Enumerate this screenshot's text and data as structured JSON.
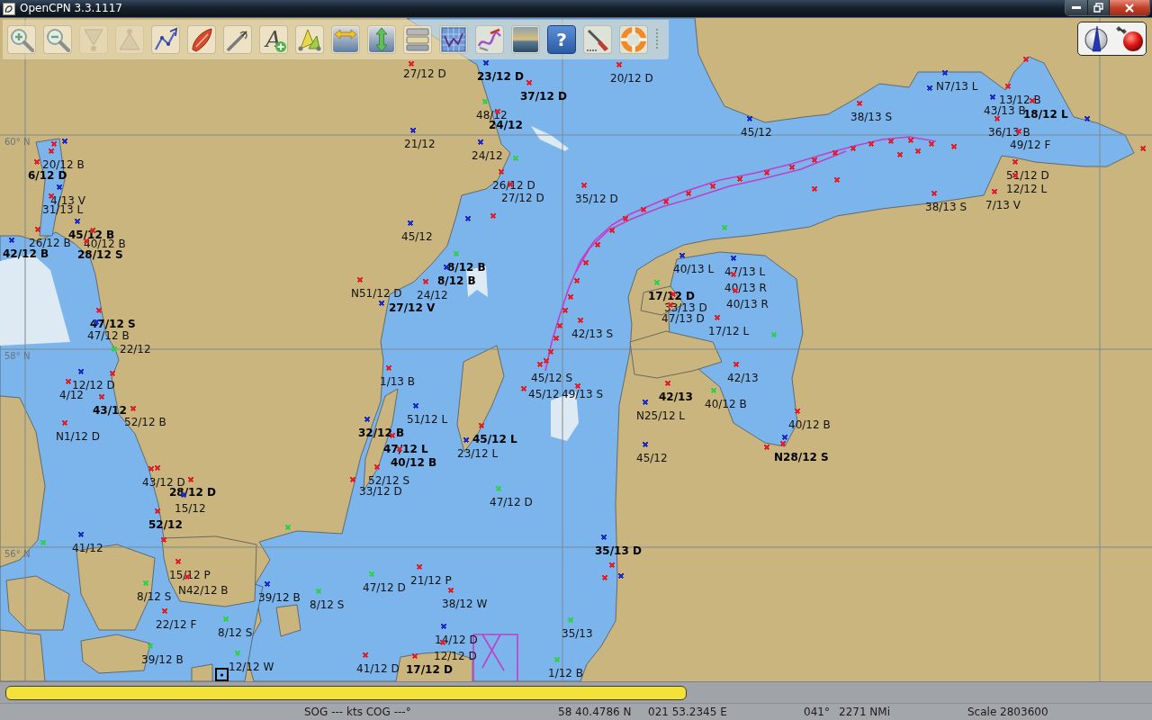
{
  "window": {
    "title": "OpenCPN 3.3.1117"
  },
  "toolbar": {
    "tools": [
      {
        "kind": "zoom_in",
        "disabled": false
      },
      {
        "kind": "zoom_out",
        "disabled": false
      },
      {
        "kind": "scale_down",
        "disabled": true
      },
      {
        "kind": "scale_up",
        "disabled": true
      },
      {
        "kind": "route",
        "disabled": false
      },
      {
        "kind": "own_ship",
        "disabled": false
      },
      {
        "kind": "measure",
        "disabled": false
      },
      {
        "kind": "add_text",
        "symbol": "A",
        "disabled": false
      },
      {
        "kind": "track",
        "disabled": false
      },
      {
        "kind": "h_arrows",
        "disabled": false
      },
      {
        "kind": "v_arrows",
        "disabled": false
      },
      {
        "kind": "layers",
        "disabled": false
      },
      {
        "kind": "graph",
        "disabled": false
      },
      {
        "kind": "route_manager",
        "disabled": false
      },
      {
        "kind": "sunset",
        "disabled": false
      },
      {
        "kind": "help",
        "symbol": "?",
        "disabled": false
      },
      {
        "kind": "brush",
        "disabled": false
      },
      {
        "kind": "lifebuoy",
        "disabled": false
      }
    ]
  },
  "compass": {
    "gps_fix": false
  },
  "chart": {
    "grid_labels": [
      "60° N",
      "58° N",
      "56° N"
    ],
    "marks": [
      {
        "name": "20/12 B",
        "color": "#e0202c"
      },
      {
        "name": "6/12 D",
        "color": "#e0202c"
      },
      {
        "name": "4/13 V",
        "color": "#1c2cc8"
      },
      {
        "name": "31/13 L",
        "color": "#e0202c"
      },
      {
        "name": "45/12 B",
        "color": "#1c2cc8"
      },
      {
        "name": "26/12 B",
        "color": "#e0202c"
      },
      {
        "name": "40/12 B",
        "color": "#e0202c"
      },
      {
        "name": "42/12 B",
        "color": "#1c2cc8"
      },
      {
        "name": "28/12 S",
        "color": "#e0202c"
      },
      {
        "name": "47/12 S",
        "color": "#e0202c"
      },
      {
        "name": "47/12 B",
        "color": "#1c2cc8"
      },
      {
        "name": "22/12",
        "color": "#2ed24a"
      },
      {
        "name": "12/12 D",
        "color": "#1c2cc8"
      },
      {
        "name": "4/12",
        "color": "#e0202c"
      },
      {
        "name": "43/12",
        "color": "#e0202c"
      },
      {
        "name": "52/12 B",
        "color": "#e0202c"
      },
      {
        "name": "N1/12 D",
        "color": "#e0202c"
      },
      {
        "name": "43/12 D",
        "color": "#e0202c"
      },
      {
        "name": "28/12 D",
        "color": "#e0202c"
      },
      {
        "name": "15/12",
        "color": "#1c2cc8"
      },
      {
        "name": "52/12",
        "color": "#e0202c"
      },
      {
        "name": "41/12",
        "color": "#1c2cc8"
      },
      {
        "name": "15/12 P",
        "color": "#e0202c"
      },
      {
        "name": "N42/12 B",
        "color": "#e0202c"
      },
      {
        "name": "8/12 S",
        "color": "#2ed24a"
      },
      {
        "name": "39/12 B",
        "color": "#1c2cc8"
      },
      {
        "name": "8/12 S",
        "color": "#2ed24a"
      },
      {
        "name": "22/12 F",
        "color": "#e0202c"
      },
      {
        "name": "8/12 S",
        "color": "#2ed24a"
      },
      {
        "name": "39/12 B",
        "color": "#2ed24a"
      },
      {
        "name": "12/12 W",
        "color": "#2ed24a"
      },
      {
        "name": "27/12 D",
        "color": "#e0202c"
      },
      {
        "name": "23/12 D",
        "color": "#1c2cc8"
      },
      {
        "name": "20/12 D",
        "color": "#e0202c"
      },
      {
        "name": "37/12 D",
        "color": "#e0202c"
      },
      {
        "name": "48/12",
        "color": "#2ed24a"
      },
      {
        "name": "24/12",
        "color": "#e0202c"
      },
      {
        "name": "45/12",
        "color": "#1c2cc8"
      },
      {
        "name": "21/12",
        "color": "#1c2cc8"
      },
      {
        "name": "24/12",
        "color": "#1c2cc8"
      },
      {
        "name": "26/12 D",
        "color": "#e0202c"
      },
      {
        "name": "27/12 D",
        "color": "#e0202c"
      },
      {
        "name": "35/12 D",
        "color": "#e0202c"
      },
      {
        "name": "45/12",
        "color": "#1c2cc8"
      },
      {
        "name": "8/12 B",
        "color": "#2ed24a"
      },
      {
        "name": "8/12 B",
        "color": "#1c2cc8"
      },
      {
        "name": "N51/12 D",
        "color": "#e0202c"
      },
      {
        "name": "24/12",
        "color": "#e0202c"
      },
      {
        "name": "27/12 V",
        "color": "#1c2cc8"
      },
      {
        "name": "42/13 S",
        "color": "#e0202c"
      },
      {
        "name": "1/13 B",
        "color": "#e0202c"
      },
      {
        "name": "45/12 S",
        "color": "#e0202c"
      },
      {
        "name": "45/12",
        "color": "#e0202c"
      },
      {
        "name": "49/13 S",
        "color": "#e0202c"
      },
      {
        "name": "42/13",
        "color": "#e0202c"
      },
      {
        "name": "42/13",
        "color": "#e0202c"
      },
      {
        "name": "40/12 B",
        "color": "#2ed24a"
      },
      {
        "name": "N25/12 L",
        "color": "#1c2cc8"
      },
      {
        "name": "51/12 L",
        "color": "#1c2cc8"
      },
      {
        "name": "32/12 B",
        "color": "#1c2cc8"
      },
      {
        "name": "40/12 B",
        "color": "#e0202c"
      },
      {
        "name": "45/12 L",
        "color": "#e0202c"
      },
      {
        "name": "47/12 L",
        "color": "#e0202c"
      },
      {
        "name": "23/12 L",
        "color": "#1c2cc8"
      },
      {
        "name": "45/12",
        "color": "#1c2cc8"
      },
      {
        "name": "N28/12 S",
        "color": "#e0202c"
      },
      {
        "name": "40/12 B",
        "color": "#e0202c"
      },
      {
        "name": "52/12 S",
        "color": "#e0202c"
      },
      {
        "name": "33/12 D",
        "color": "#e0202c"
      },
      {
        "name": "47/12 D",
        "color": "#2ed24a"
      },
      {
        "name": "35/13 D",
        "color": "#1c2cc8"
      },
      {
        "name": "21/12 P",
        "color": "#e0202c"
      },
      {
        "name": "47/12 D",
        "color": "#2ed24a"
      },
      {
        "name": "38/12 W",
        "color": "#e0202c"
      },
      {
        "name": "35/13",
        "color": "#2ed24a"
      },
      {
        "name": "14/12 D",
        "color": "#1c2cc8"
      },
      {
        "name": "12/12 D",
        "color": "#e0202c"
      },
      {
        "name": "41/12 D",
        "color": "#e0202c"
      },
      {
        "name": "17/12 D",
        "color": "#e0202c"
      },
      {
        "name": "1/12 B",
        "color": "#2ed24a"
      },
      {
        "name": "N7/13 L",
        "color": "#1c2cc8"
      },
      {
        "name": "13/12 B",
        "color": "#e0202c"
      },
      {
        "name": "38/13 S",
        "color": "#e0202c"
      },
      {
        "name": "43/13 B",
        "color": "#1c2cc8"
      },
      {
        "name": "18/12 L",
        "color": "#e0202c"
      },
      {
        "name": "36/13 B",
        "color": "#e0202c"
      },
      {
        "name": "49/12 F",
        "color": "#e0202c"
      },
      {
        "name": "51/12 D",
        "color": "#e0202c"
      },
      {
        "name": "12/12 L",
        "color": "#e0202c"
      },
      {
        "name": "38/13 S",
        "color": "#e0202c"
      },
      {
        "name": "7/13 V",
        "color": "#e0202c"
      },
      {
        "name": "40/13 L",
        "color": "#1c2cc8"
      },
      {
        "name": "47/13 L",
        "color": "#1c2cc8"
      },
      {
        "name": "17/12 D",
        "color": "#2ed24a"
      },
      {
        "name": "40/13 R",
        "color": "#e0202c"
      },
      {
        "name": "33/13 D",
        "color": "#e0202c"
      },
      {
        "name": "40/13 R",
        "color": "#e0202c"
      },
      {
        "name": "47/13 D",
        "color": "#e0202c"
      },
      {
        "name": "17/12 L",
        "color": "#e0202c"
      }
    ],
    "markers": [
      {
        "color": "#e0202c"
      },
      {
        "color": "#e0202c"
      },
      {
        "color": "#e0202c"
      },
      {
        "color": "#e0202c"
      },
      {
        "color": "#e0202c"
      },
      {
        "color": "#e0202c"
      },
      {
        "color": "#e0202c"
      },
      {
        "color": "#e0202c"
      },
      {
        "color": "#e0202c"
      },
      {
        "color": "#e0202c"
      },
      {
        "color": "#e0202c"
      },
      {
        "color": "#e0202c"
      },
      {
        "color": "#e0202c"
      },
      {
        "color": "#e0202c"
      },
      {
        "color": "#e0202c"
      },
      {
        "color": "#e0202c"
      },
      {
        "color": "#e0202c"
      },
      {
        "color": "#e0202c"
      },
      {
        "color": "#e0202c"
      },
      {
        "color": "#e0202c"
      },
      {
        "color": "#e0202c"
      },
      {
        "color": "#e0202c"
      },
      {
        "color": "#e0202c"
      },
      {
        "color": "#e0202c"
      },
      {
        "color": "#e0202c"
      },
      {
        "color": "#e0202c"
      },
      {
        "color": "#1c2cc8"
      },
      {
        "color": "#e0202c"
      },
      {
        "color": "#1c2cc8"
      },
      {
        "color": "#e0202c"
      },
      {
        "color": "#e0202c"
      },
      {
        "color": "#e0202c"
      },
      {
        "color": "#e0202c"
      },
      {
        "color": "#e0202c"
      },
      {
        "color": "#e0202c"
      },
      {
        "color": "#1c2cc8"
      },
      {
        "color": "#2ed24a"
      },
      {
        "color": "#2ed24a"
      },
      {
        "color": "#2ed24a"
      },
      {
        "color": "#2ed24a"
      },
      {
        "color": "#2ed24a"
      },
      {
        "color": "#e0202c"
      },
      {
        "color": "#1c2cc8"
      },
      {
        "color": "#e0202c"
      },
      {
        "color": "#e0202c"
      },
      {
        "color": "#1c2cc8"
      },
      {
        "color": "#e0202c"
      },
      {
        "color": "#e0202c"
      },
      {
        "color": "#e0202c"
      },
      {
        "color": "#e0202c"
      },
      {
        "color": "#1c2cc8"
      }
    ]
  },
  "chart_bar": {
    "keys": [
      {
        "color": "#f2e23a"
      }
    ]
  },
  "status_bar": {
    "sog_cog": "SOG --- kts COG ---°",
    "latitude": "58 40.4786 N",
    "longitude": "021 53.2345 E",
    "bearing": "041°",
    "distance": "2271 NMi",
    "scale": "Scale 2803600"
  }
}
